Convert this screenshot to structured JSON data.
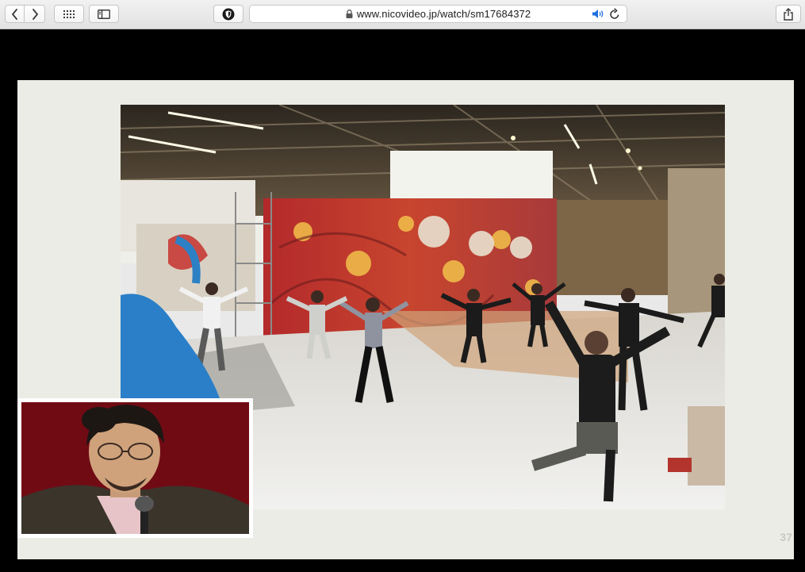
{
  "browser": {
    "url": "www.nicovideo.jp/watch/sm17684372",
    "audio_playing": true,
    "buttons": {
      "back": "chevron-left-icon",
      "forward": "chevron-right-icon",
      "top_sites": "grid-icon",
      "sidebar": "sidebar-icon",
      "extension": "shield-icon",
      "share": "share-icon"
    }
  },
  "video": {
    "slide_number": "37"
  },
  "colors": {
    "slide_bg": "#ecece6",
    "pip_bg": "#7a0d16",
    "floor": "#e9e9e9",
    "mural_red": "#b8262a"
  }
}
